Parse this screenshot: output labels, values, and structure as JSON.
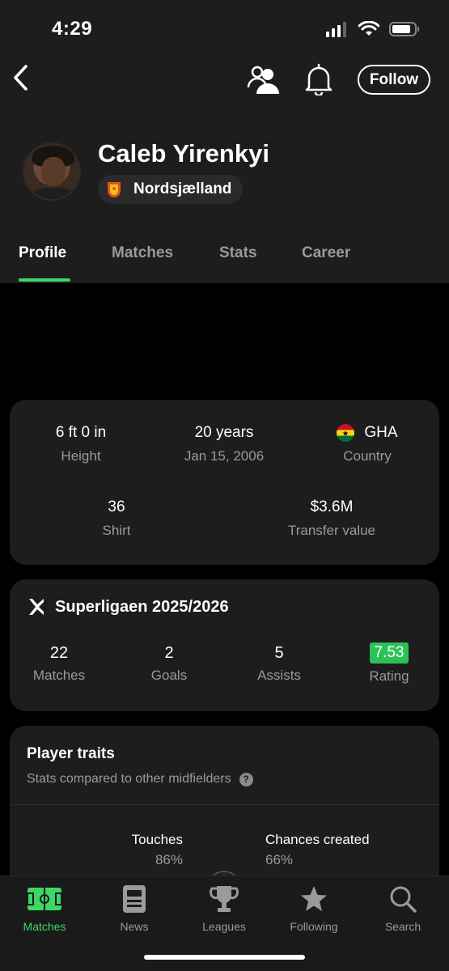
{
  "status_bar": {
    "time": "4:29"
  },
  "header": {
    "follow_label": "Follow"
  },
  "player": {
    "name": "Caleb Yirenkyi",
    "team": "Nordsjælland"
  },
  "tabs": [
    {
      "label": "Profile",
      "active": true
    },
    {
      "label": "Matches",
      "active": false
    },
    {
      "label": "Stats",
      "active": false
    },
    {
      "label": "Career",
      "active": false
    }
  ],
  "info": {
    "height": {
      "value": "6 ft 0 in",
      "label": "Height"
    },
    "age": {
      "value": "20 years",
      "label": "Jan 15, 2006"
    },
    "country": {
      "value": "GHA",
      "label": "Country"
    },
    "shirt": {
      "value": "36",
      "label": "Shirt"
    },
    "transfer": {
      "value": "$3.6M",
      "label": "Transfer value"
    }
  },
  "league": {
    "title": "Superligaen 2025/2026",
    "stats": [
      {
        "value": "22",
        "label": "Matches"
      },
      {
        "value": "2",
        "label": "Goals"
      },
      {
        "value": "5",
        "label": "Assists"
      },
      {
        "value": "7.53",
        "label": "Rating"
      }
    ],
    "rating_color": "#2cc257"
  },
  "traits": {
    "title": "Player traits",
    "subtitle": "Stats compared to other midfielders",
    "help_icon_text": "?",
    "items": [
      {
        "label": "Touches",
        "pct": "86%"
      },
      {
        "label": "Chances created",
        "pct": "66%"
      }
    ]
  },
  "bottom_nav": [
    {
      "label": "Matches",
      "icon": "pitch-icon",
      "active": true
    },
    {
      "label": "News",
      "icon": "news-icon",
      "active": false
    },
    {
      "label": "Leagues",
      "icon": "trophy-icon",
      "active": false
    },
    {
      "label": "Following",
      "icon": "star-icon",
      "active": false
    },
    {
      "label": "Search",
      "icon": "search-icon",
      "active": false
    }
  ],
  "colors": {
    "accent": "#3ed665",
    "background": "#000000",
    "card": "#1d1d1d"
  }
}
